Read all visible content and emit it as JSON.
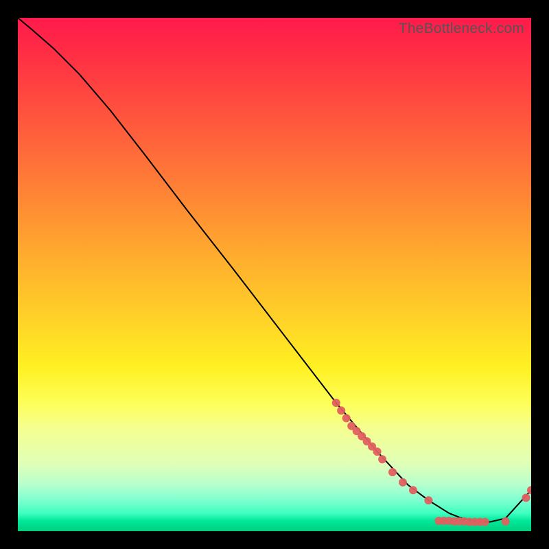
{
  "watermark": "TheBottleneck.com",
  "chart_data": {
    "type": "line",
    "title": "",
    "xlabel": "",
    "ylabel": "",
    "xlim": [
      0,
      100
    ],
    "ylim": [
      0,
      100
    ],
    "grid": false,
    "note": "Axes are unlabeled; values are normalized 0–100 estimated from pixel positions.",
    "series": [
      {
        "name": "curve",
        "type": "line",
        "color": "#000000",
        "x": [
          0,
          3,
          7,
          12,
          18,
          25,
          33,
          42,
          52,
          62,
          70,
          76,
          80,
          84,
          87,
          90,
          92,
          95,
          100
        ],
        "y": [
          100,
          97.5,
          94,
          89,
          82,
          73,
          62.5,
          51,
          38,
          25,
          15.5,
          9,
          6,
          3.5,
          2.3,
          1.8,
          1.8,
          2.5,
          8
        ]
      },
      {
        "name": "cluster-points",
        "type": "scatter",
        "color": "#e06060",
        "x": [
          62,
          63,
          64,
          65,
          66,
          67,
          68,
          69,
          70,
          71,
          73,
          75,
          77,
          80,
          82,
          83,
          84,
          85,
          86,
          87,
          88,
          89,
          90,
          91,
          95,
          99,
          100
        ],
        "y": [
          25,
          23.5,
          22,
          20.5,
          19.5,
          18.5,
          17.5,
          16.5,
          15.5,
          14,
          11.5,
          9.5,
          8,
          6,
          2,
          2,
          2,
          1.9,
          1.9,
          1.9,
          1.8,
          1.8,
          1.8,
          1.8,
          1.9,
          6.5,
          8
        ]
      }
    ]
  }
}
